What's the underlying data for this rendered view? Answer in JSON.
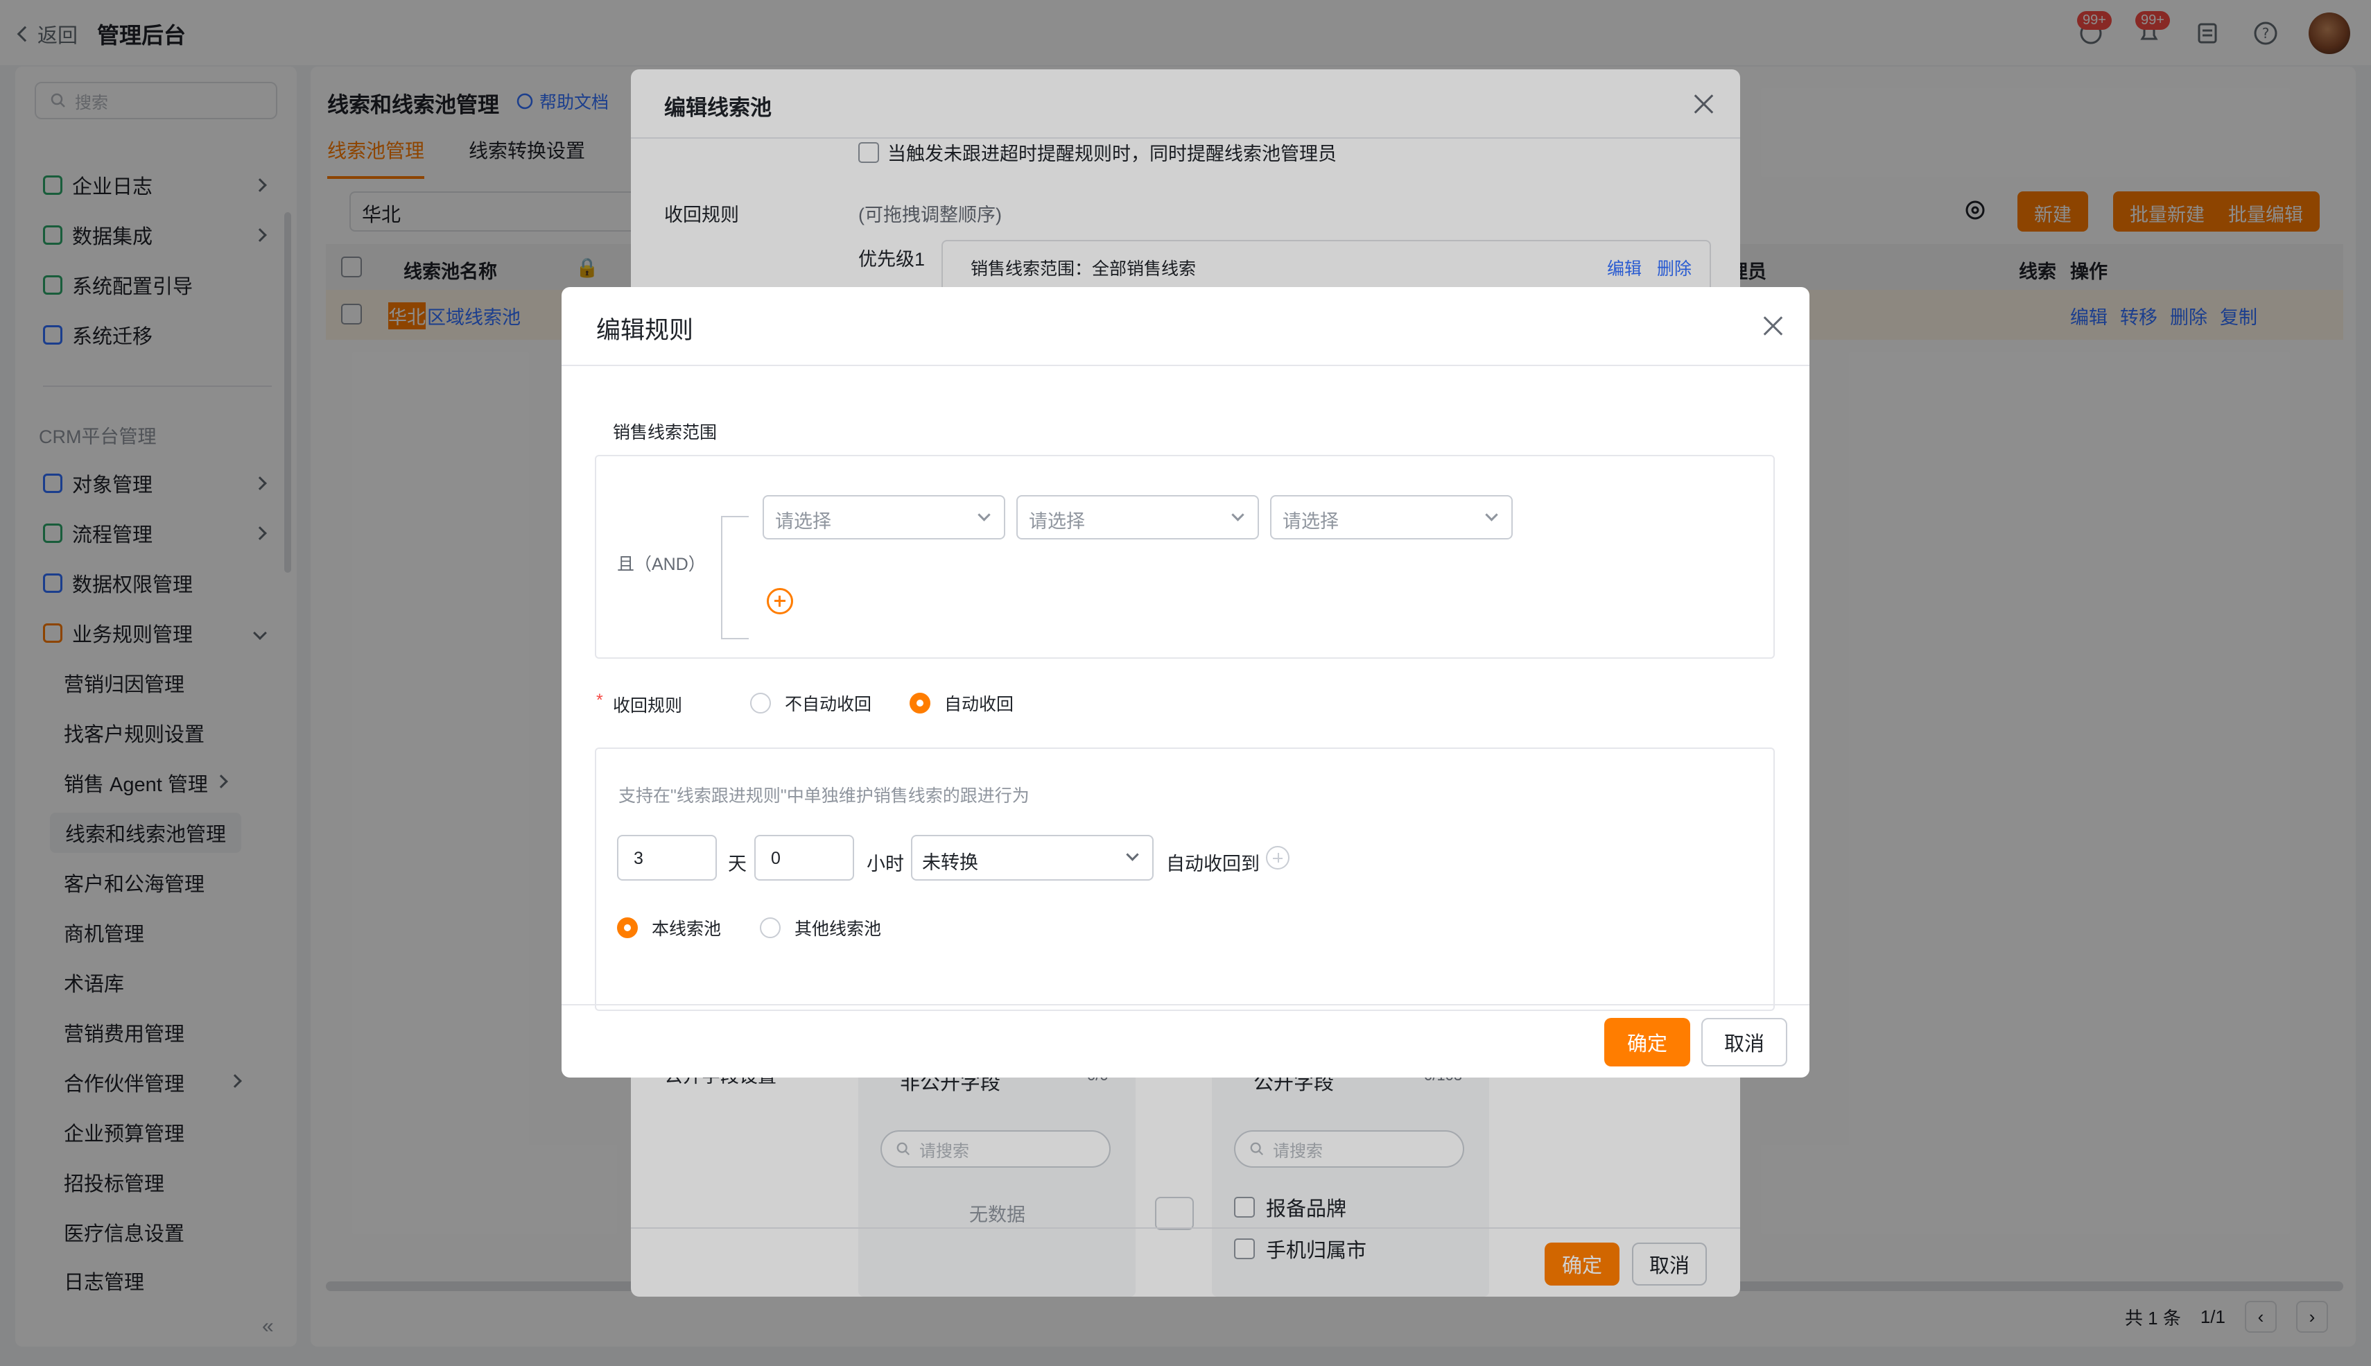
{
  "topbar": {
    "back_label": "返回",
    "app_title": "管理后台",
    "badge_1": "99+",
    "badge_2": "99+"
  },
  "sidebar": {
    "search_placeholder": "搜索",
    "items_top": [
      {
        "label": "企业日志"
      },
      {
        "label": "数据集成"
      },
      {
        "label": "系统配置引导"
      },
      {
        "label": "系统迁移"
      }
    ],
    "section_label": "CRM平台管理",
    "items_crm": [
      {
        "label": "对象管理"
      },
      {
        "label": "流程管理"
      },
      {
        "label": "数据权限管理"
      },
      {
        "label": "业务规则管理"
      }
    ],
    "sub_items": [
      {
        "label": "营销归因管理"
      },
      {
        "label": "找客户规则设置"
      },
      {
        "label": "销售 Agent 管理"
      },
      {
        "label": "线索和线索池管理"
      },
      {
        "label": "客户和公海管理"
      },
      {
        "label": "商机管理"
      },
      {
        "label": "术语库"
      },
      {
        "label": "营销费用管理"
      },
      {
        "label": "合作伙伴管理"
      },
      {
        "label": "企业预算管理"
      },
      {
        "label": "招投标管理"
      },
      {
        "label": "医疗信息设置"
      },
      {
        "label": "日志管理"
      }
    ]
  },
  "main": {
    "title": "线索和线索池管理",
    "help": "帮助文档",
    "tabs": [
      {
        "label": "线索池管理"
      },
      {
        "label": "线索转换设置"
      }
    ],
    "filter_value": "华北",
    "buttons": {
      "new": "新建",
      "batch_new": "批量新建",
      "batch_edit": "批量编辑"
    },
    "table": {
      "col_name": "线索池名称",
      "col_admin": "理员",
      "col_lead": "线索",
      "col_ops": "操作",
      "row_hl": "华北",
      "row_name": "区域线索池",
      "ops": [
        "编辑",
        "转移",
        "删除",
        "复制"
      ]
    },
    "pager": {
      "total": "共 1 条",
      "page": "1/1"
    }
  },
  "drawer": {
    "title": "编辑线索池",
    "check_label": "当触发未跟进超时提醒规则时，同时提醒线索池管理员",
    "recycle_label": "收回规则",
    "recycle_hint": "(可拖拽调整顺序)",
    "priority_label": "优先级1",
    "priority_scope": "销售线索范围：全部销售线索",
    "priority_edit": "编辑",
    "priority_delete": "删除",
    "public_label": "公开字段设置",
    "left_list_title": "非公开字段",
    "left_count": "0/0",
    "right_list_title": "公开字段",
    "right_count": "0/103",
    "search_placeholder": "请搜索",
    "empty": "无数据",
    "right_items": [
      "报备品牌",
      "手机归属市"
    ],
    "ok": "确定",
    "cancel": "取消"
  },
  "modal": {
    "title": "编辑规则",
    "scope_label": "销售线索范围",
    "and_label": "且（AND）",
    "select_placeholder": "请选择",
    "recycle_label": "收回规则",
    "radio_no": "不自动收回",
    "radio_auto": "自动收回",
    "hint": "支持在\"线索跟进规则\"中单独维护销售线索的跟进行为",
    "days_value": "3",
    "days_unit": "天",
    "hours_value": "0",
    "hours_unit": "小时",
    "status_value": "未转换",
    "auto_recycle_to": "自动收回到",
    "pool_this": "本线索池",
    "pool_other": "其他线索池",
    "ok": "确定",
    "cancel": "取消"
  },
  "colors": {
    "accent": "#ff7d00",
    "link": "#3370ff",
    "danger": "#f54a45"
  }
}
